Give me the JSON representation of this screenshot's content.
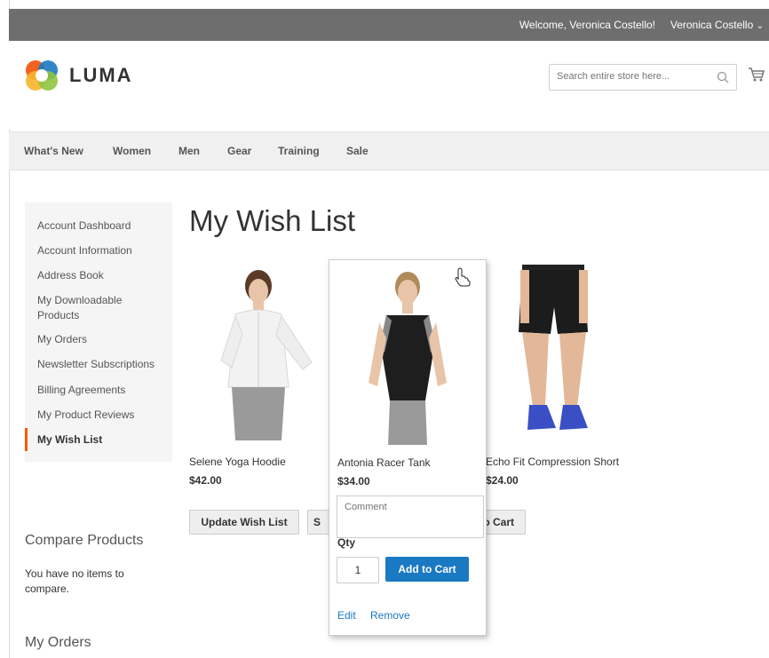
{
  "topbar": {
    "welcome": "Welcome, Veronica Costello!",
    "user_name": "Veronica Costello",
    "user_chevron": "⌄"
  },
  "header": {
    "logo_text": "LUMA",
    "search_placeholder": "Search entire store here...",
    "colors": {
      "logo_orange": "#f26322",
      "logo_blue": "#1979c3",
      "logo_green": "#8fc43f",
      "logo_yellow": "#f7b52c"
    }
  },
  "nav": {
    "items": [
      "What's New",
      "Women",
      "Men",
      "Gear",
      "Training",
      "Sale"
    ]
  },
  "sidebar": {
    "items": [
      "Account Dashboard",
      "Account Information",
      "Address Book",
      "My Downloadable Products",
      "My Orders",
      "Newsletter Subscriptions",
      "Billing Agreements",
      "My Product Reviews",
      "My Wish List"
    ],
    "active": "My Wish List",
    "accent_color": "#ff5501"
  },
  "compare": {
    "title": "Compare Products",
    "text": "You have no items to compare."
  },
  "orders": {
    "title": "My Orders"
  },
  "main": {
    "title": "My Wish List",
    "products": [
      {
        "name": "Selene Yoga Hoodie",
        "price": "$42.00"
      },
      {
        "name": "Antonia Racer Tank",
        "price": "$34.00"
      },
      {
        "name": "Echo Fit Compression Short",
        "price": "$24.00"
      }
    ],
    "update_button": "Update Wish List",
    "share_button_partial": "S",
    "add_all_partial": "o Cart"
  },
  "hover_card": {
    "comment_placeholder": "Comment",
    "qty_label": "Qty",
    "qty_value": "1",
    "add_to_cart": "Add to Cart",
    "edit": "Edit",
    "remove": "Remove"
  }
}
